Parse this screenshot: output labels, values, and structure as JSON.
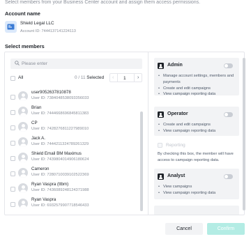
{
  "intro_text": "Select members from your Business Center account and assign them access permissions.",
  "account": {
    "section_title": "Account name",
    "name": "Shield Legal LLC",
    "id": "Account ID: 7444137141224113"
  },
  "members": {
    "section_title": "Select members",
    "search_placeholder": "Please enter",
    "all_label": "All",
    "count_text": "0 / 11",
    "selected_label": "Selected",
    "page_number": "1",
    "rows": [
      {
        "name": "user9052637810878",
        "id": "User ID: 7384048538093356033"
      },
      {
        "name": "Brian",
        "id": "User ID: 7444668696845811383"
      },
      {
        "name": "CP",
        "id": "User ID: 7428276811227989010"
      },
      {
        "name": "Jack A.",
        "id": "User ID: 7444211324789261329"
      },
      {
        "name": "Shield Email BM Maximus",
        "id": "User ID: 7439804014906180624"
      },
      {
        "name": "Cameron",
        "id": "User ID: 7280710039102522369"
      },
      {
        "name": "Ryan Vaspra (ttbm)",
        "id": "User ID: 7436089248124371988"
      },
      {
        "name": "Ryan Vaspra",
        "id": "User ID: 6932579907718546433"
      }
    ]
  },
  "roles": [
    {
      "title": "Admin",
      "enabled": false,
      "permissions": [
        "Manage account settings, members and payments",
        "Create and edit campaigns",
        "View campaign reporting data"
      ]
    },
    {
      "title": "Operator",
      "enabled": false,
      "permissions": [
        "Create and edit campaigns",
        "View campaign reporting data"
      ]
    },
    {
      "title": "Analyst",
      "enabled": false,
      "permissions": [
        "View campaigns",
        "View campaign reporting data"
      ]
    }
  ],
  "reporting": {
    "label": "Reporting",
    "description": "By checking this box, the member will have access to campaign reporting data."
  },
  "footer": {
    "cancel_label": "Cancel",
    "confirm_label": "Confirm"
  },
  "colors": {
    "confirm_disabled": "#b3ece4",
    "text_primary": "#1f2329",
    "text_secondary": "#8a8f99"
  }
}
